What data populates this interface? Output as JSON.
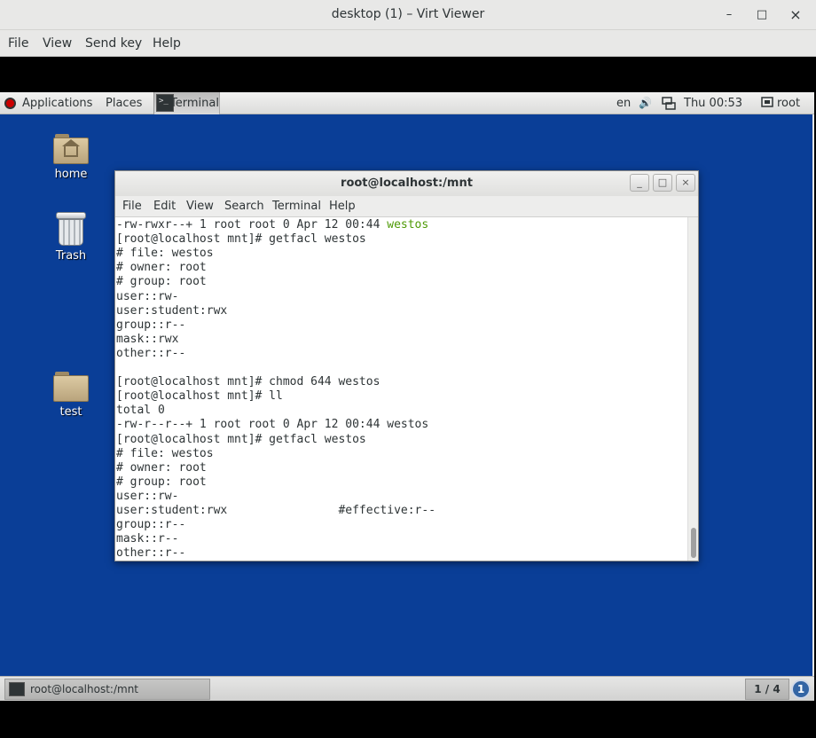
{
  "viewer": {
    "title": "desktop (1) – Virt Viewer",
    "minimize": "–",
    "maximize": "□",
    "close": "×",
    "menu": [
      "File",
      "View",
      "Send key",
      "Help"
    ]
  },
  "top_panel": {
    "applications": "Applications",
    "places": "Places",
    "terminal_task": "Terminal",
    "language": "en",
    "volume_icon": "speaker-icon",
    "network_icon": "network-icon",
    "clock": "Thu 00:53",
    "user": "root"
  },
  "desktop": {
    "icons": [
      {
        "label": "home",
        "icon": "home-folder-icon"
      },
      {
        "label": "Trash",
        "icon": "trash-icon"
      },
      {
        "label": "test",
        "icon": "folder-icon"
      }
    ]
  },
  "terminal": {
    "title": "root@localhost:/mnt",
    "controls": [
      "_",
      "□",
      "×"
    ],
    "menu": [
      "File",
      "Edit",
      "View",
      "Search",
      "Terminal",
      "Help"
    ],
    "first_line_prefix": "-rw-rwxr--+ 1 root root 0 Apr 12 00:44 ",
    "first_line_file": "westos",
    "lines": [
      "[root@localhost mnt]# getfacl westos",
      "# file: westos",
      "# owner: root",
      "# group: root",
      "user::rw-",
      "user:student:rwx",
      "group::r--",
      "mask::rwx",
      "other::r--",
      "",
      "[root@localhost mnt]# chmod 644 westos",
      "[root@localhost mnt]# ll",
      "total 0",
      "-rw-r--r--+ 1 root root 0 Apr 12 00:44 westos",
      "[root@localhost mnt]# getfacl westos",
      "# file: westos",
      "# owner: root",
      "# group: root",
      "user::rw-",
      "user:student:rwx                #effective:r--",
      "group::r--",
      "mask::r--",
      "other::r--"
    ]
  },
  "bottom_panel": {
    "task_label": "root@localhost:/mnt",
    "workspace": "1 / 4",
    "notification_count": "1"
  },
  "colors": {
    "desktop_bg": "#0a3e97",
    "ls_file_green": "#4e9a06"
  }
}
